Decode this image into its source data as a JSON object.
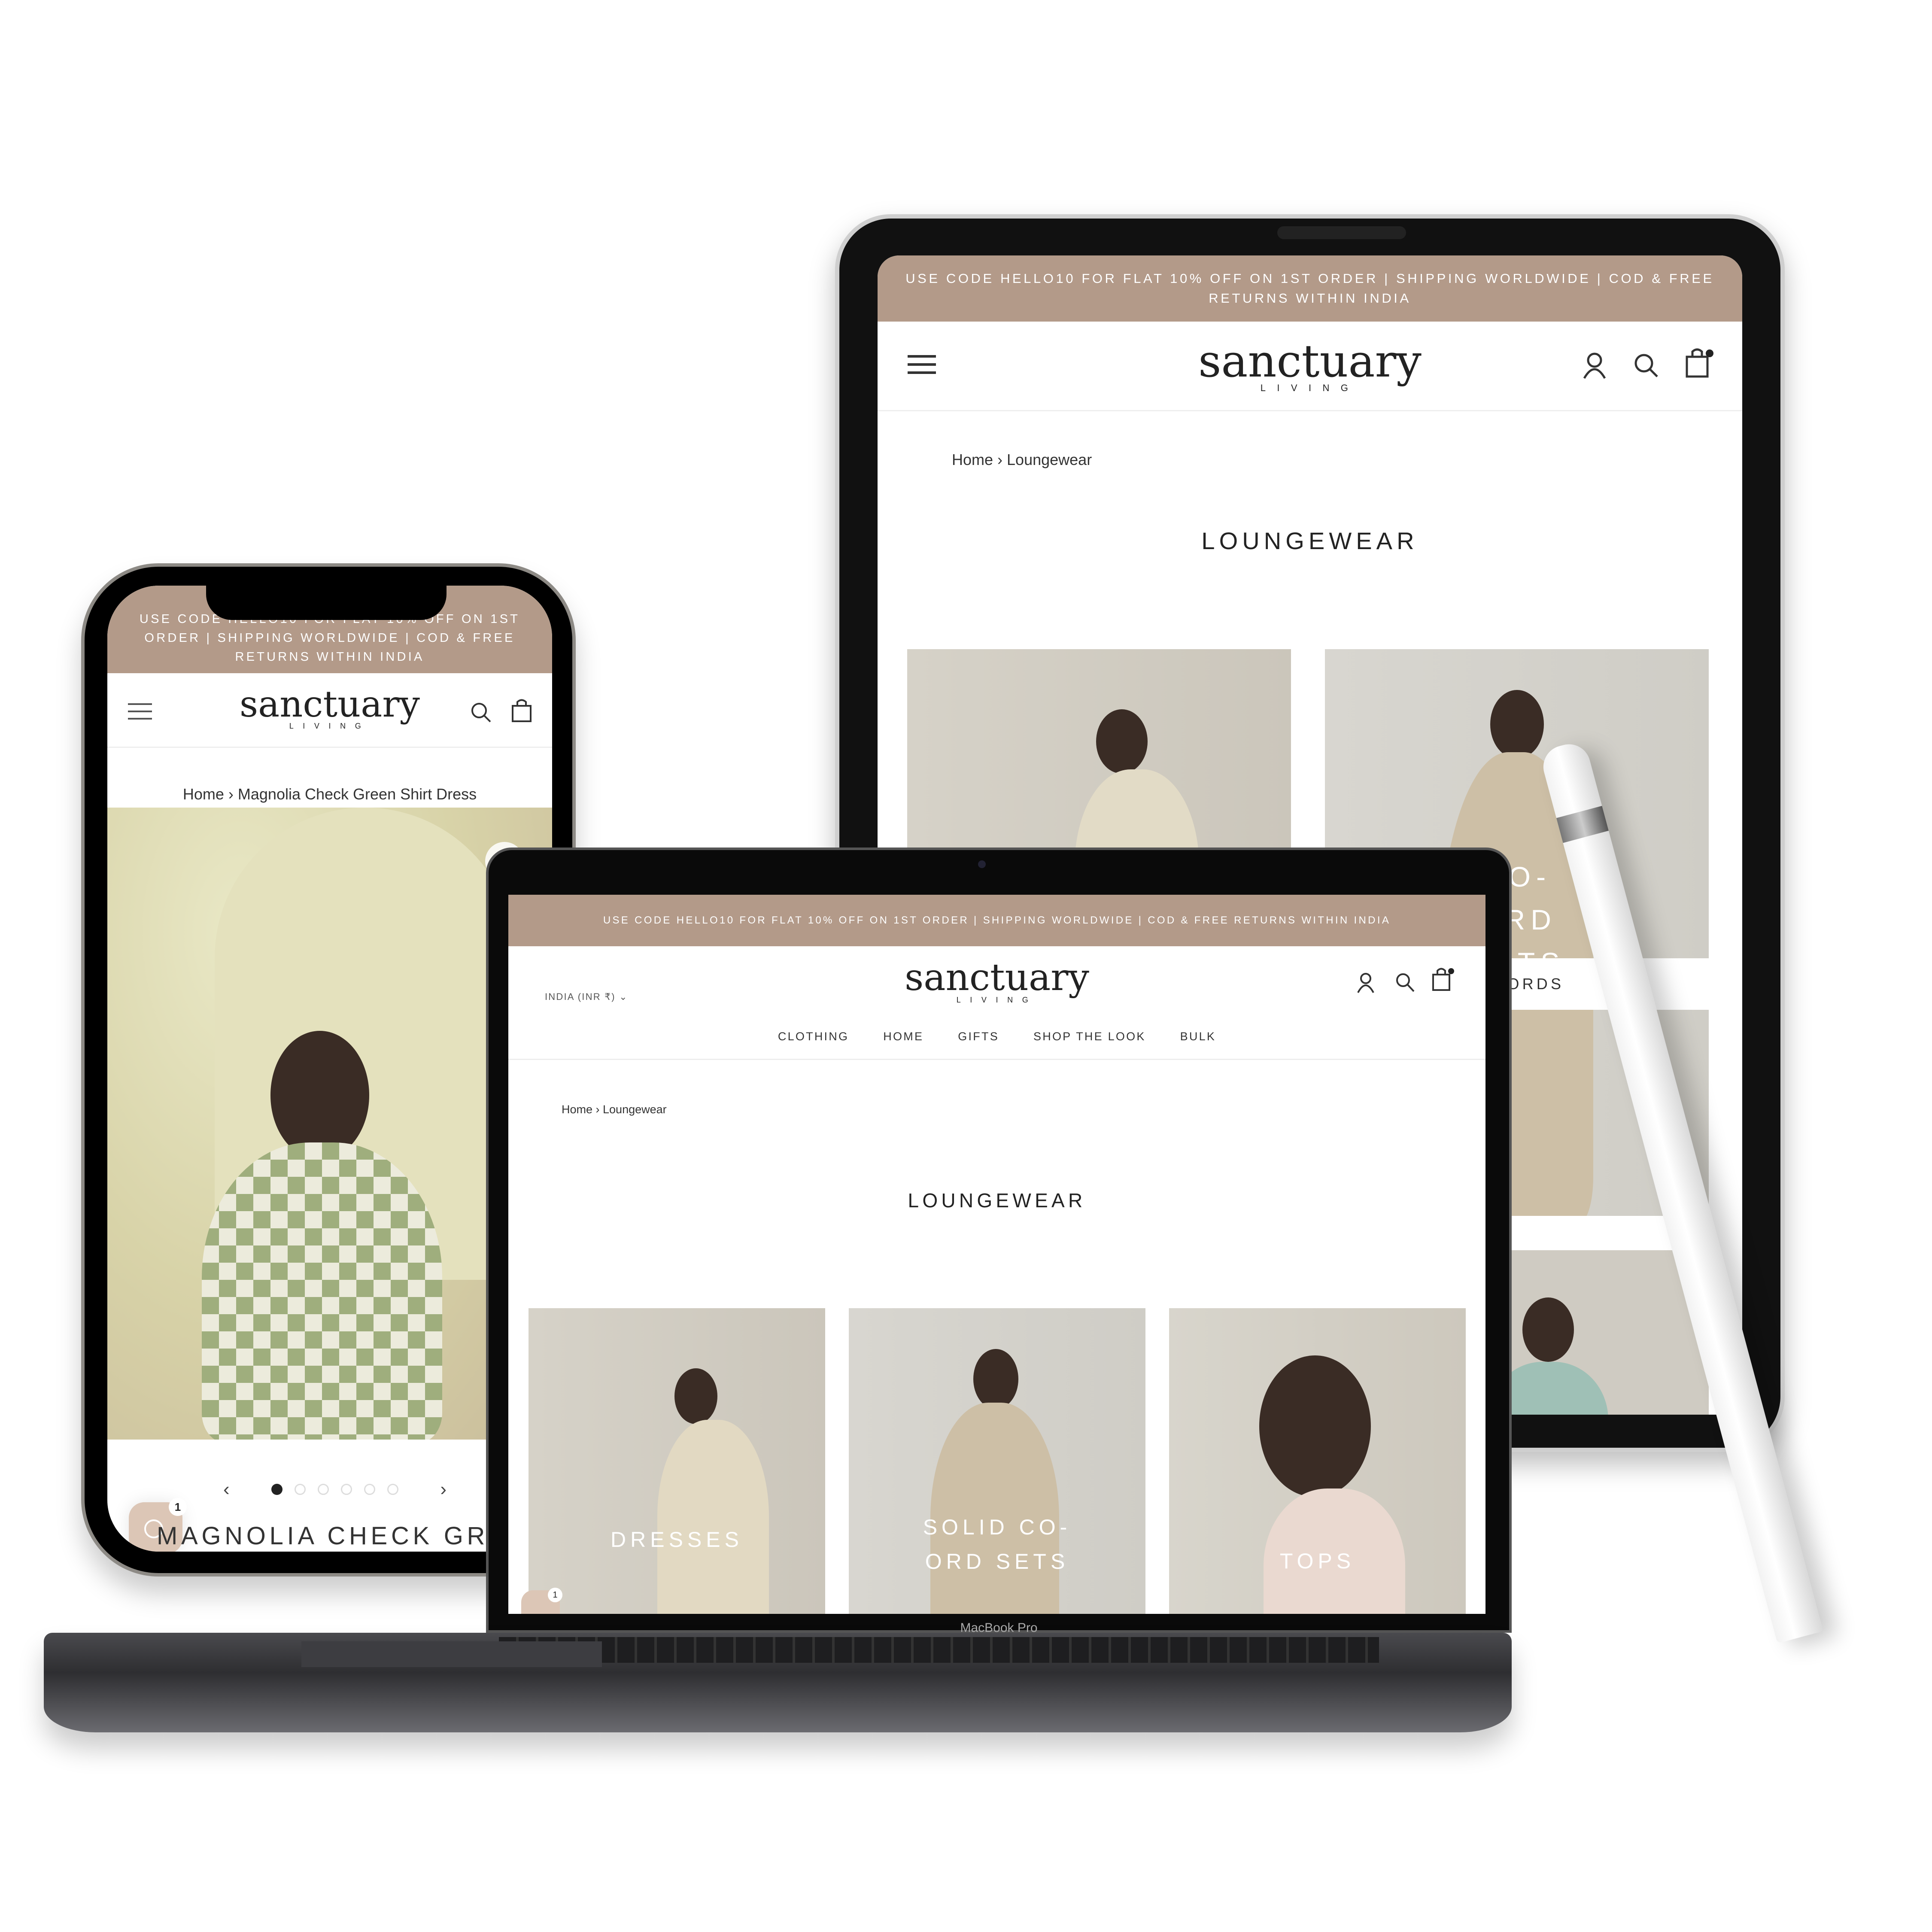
{
  "brand": {
    "name": "sanctuary",
    "sub": "LIVING",
    "accent": "#b39a89"
  },
  "announcement": "USE CODE HELLO10 FOR FLAT 10% OFF ON 1ST ORDER | SHIPPING WORLDWIDE | COD & FREE RETURNS WITHIN INDIA",
  "tablet": {
    "breadcrumb": "Home › Loungewear",
    "title": "LOUNGEWEAR",
    "tiles": [
      {
        "label": ""
      },
      {
        "label": "CO-ORD SETS"
      }
    ],
    "sub_label": "CO-ORDS"
  },
  "laptop": {
    "currency": "INDIA (INR ₹)",
    "nav": [
      "CLOTHING",
      "HOME",
      "GIFTS",
      "SHOP THE LOOK",
      "BULK"
    ],
    "breadcrumb": "Home › Loungewear",
    "title": "LOUNGEWEAR",
    "tiles": [
      {
        "label": "DRESSES"
      },
      {
        "label": "SOLID CO-ORD SETS"
      },
      {
        "label": "TOPS"
      }
    ],
    "device_label": "MacBook Pro",
    "chat_badge": "1"
  },
  "phone": {
    "breadcrumb": "Home › Magnolia Check Green Shirt Dress",
    "product_title": "MAGNOLIA CHECK GREE",
    "carousel": {
      "total": 6,
      "active": 1
    },
    "chat_badge": "1"
  }
}
